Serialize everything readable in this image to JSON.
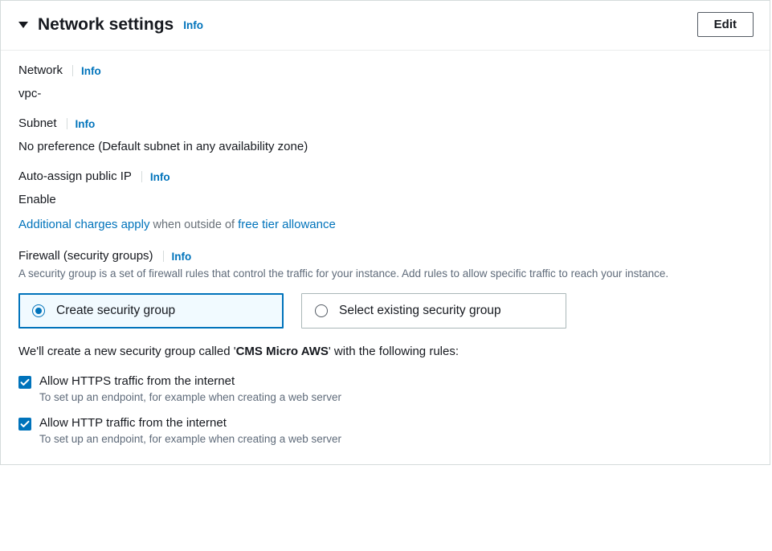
{
  "header": {
    "title": "Network settings",
    "info": "Info",
    "edit": "Edit"
  },
  "network": {
    "label": "Network",
    "info": "Info",
    "value": "vpc-"
  },
  "subnet": {
    "label": "Subnet",
    "info": "Info",
    "value": "No preference (Default subnet in any availability zone)"
  },
  "public_ip": {
    "label": "Auto-assign public IP",
    "info": "Info",
    "value": "Enable"
  },
  "charges": {
    "link1": "Additional charges apply",
    "mid": " when outside of ",
    "link2": "free tier allowance"
  },
  "firewall": {
    "label": "Firewall (security groups)",
    "info": "Info",
    "help": "A security group is a set of firewall rules that control the traffic for your instance. Add rules to allow specific traffic to reach your instance.",
    "option_create": "Create security group",
    "option_select": "Select existing security group"
  },
  "sg_create": {
    "prefix": "We'll create a new security group called '",
    "name": "CMS Micro AWS",
    "suffix": "' with the following rules:"
  },
  "rules": {
    "https": {
      "label": "Allow HTTPS traffic from the internet",
      "help": "To set up an endpoint, for example when creating a web server"
    },
    "http": {
      "label": "Allow HTTP traffic from the internet",
      "help": "To set up an endpoint, for example when creating a web server"
    }
  }
}
